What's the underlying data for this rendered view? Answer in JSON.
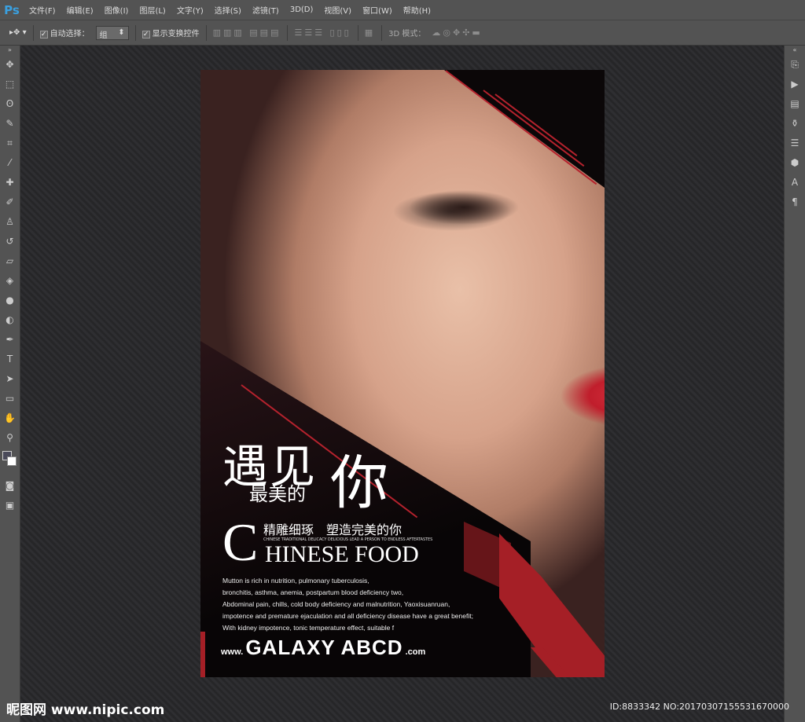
{
  "app": {
    "logo": "Ps"
  },
  "menu": [
    "文件(F)",
    "编辑(E)",
    "图像(I)",
    "图层(L)",
    "文字(Y)",
    "选择(S)",
    "滤镜(T)",
    "3D(D)",
    "视图(V)",
    "窗口(W)",
    "帮助(H)"
  ],
  "options": {
    "auto_select_label": "自动选择：",
    "auto_select_value": "组",
    "show_transform_label": "显示变换控件",
    "mode_3d_label": "3D 模式：",
    "auto_select_checked": true,
    "show_transform_checked": true
  },
  "poster": {
    "title_line": "遇见",
    "title_you": "你",
    "subtitle": "最美的",
    "cn_slogan": "精雕细琢　塑造完美的你",
    "tiny_line": "CHINESE TRADITIONAL DELICACY DELICIOUS LEAD A PERSON TO ENDLESS AFTERTASTES",
    "big_c": "C",
    "food_title": "HINESE FOOD",
    "body": [
      "Mutton is rich in nutrition, pulmonary tuberculosis,",
      "bronchitis, asthma, anemia, postpartum blood deficiency two,",
      "Abdominal pain, chills, cold body deficiency and malnutrition, Yaoxisuanruan,",
      "impotence and premature ejaculation and all deficiency disease have a great benefit;",
      "With kidney impotence, tonic temperature effect, suitable f"
    ],
    "url_prefix": "www.",
    "url_main": "GALAXY ABCD",
    "url_suffix": ".com",
    "accent": "#a51f26"
  },
  "footer": {
    "watermark": "昵图网 www.nipic.com",
    "id": "ID:8833342 NO:20170307155531670000"
  }
}
